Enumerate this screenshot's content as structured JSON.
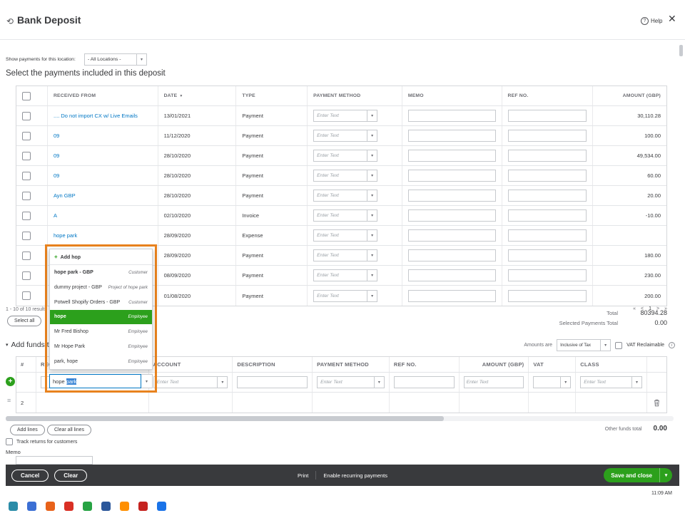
{
  "colors": {
    "accent_green": "#2ca01c",
    "link_blue": "#0077c5",
    "footer_bg": "#393a3d",
    "highlight_orange": "#e8821e"
  },
  "icons": {
    "refresh": "⟲",
    "help_mark": "?",
    "close": "✕",
    "sort_desc": "▼",
    "chevron_down": "▾",
    "info_letter": "i",
    "handle": "≡",
    "plus": "+"
  },
  "header": {
    "title": "Bank Deposit",
    "help": "Help"
  },
  "location": {
    "label": "Show payments for this location:",
    "value": "- All Locations -"
  },
  "payments": {
    "title": "Select the payments included in this deposit",
    "col_received": "RECEIVED FROM",
    "col_date": "DATE",
    "col_type": "TYPE",
    "col_method": "PAYMENT METHOD",
    "col_memo": "MEMO",
    "col_ref": "REF NO.",
    "col_amount": "AMOUNT (GBP)",
    "method_placeholder": "Enter Text",
    "rows": [
      {
        "received_from": ".... Do not import CX w/ Live Emails",
        "date": "13/01/2021",
        "type": "Payment",
        "amount": "30,110.28"
      },
      {
        "received_from": "09",
        "date": "11/12/2020",
        "type": "Payment",
        "amount": "100.00"
      },
      {
        "received_from": "09",
        "date": "28/10/2020",
        "type": "Payment",
        "amount": "49,534.00"
      },
      {
        "received_from": "09",
        "date": "28/10/2020",
        "type": "Payment",
        "amount": "60.00"
      },
      {
        "received_from": "Ayn GBP",
        "date": "28/10/2020",
        "type": "Payment",
        "amount": "20.00"
      },
      {
        "received_from": "A",
        "date": "02/10/2020",
        "type": "Invoice",
        "amount": "-10.00"
      },
      {
        "received_from": "hope park",
        "date": "28/09/2020",
        "type": "Expense",
        "amount": ""
      },
      {
        "received_from": "",
        "date": "28/09/2020",
        "type": "Payment",
        "amount": "180.00"
      },
      {
        "received_from": "",
        "date": "08/09/2020",
        "type": "Payment",
        "amount": "230.00"
      },
      {
        "received_from": "",
        "date": "01/08/2020",
        "type": "Payment",
        "amount": "200.00"
      }
    ],
    "results_summary": "1 - 10 of 10 results",
    "pager": {
      "first": "«",
      "prev": "<",
      "page": "1",
      "next": ">",
      "last": "»"
    },
    "select_all": "Select all",
    "total_label": "Total",
    "total_value": "80394.28",
    "selected_total_label": "Selected Payments Total",
    "selected_total_value": "0.00"
  },
  "name_dropdown": {
    "add_new": "Add hop",
    "items": [
      {
        "name": "hope park - GBP",
        "tag": "Customer"
      },
      {
        "name": "dummy project - GBP",
        "tag": "Project of hope park"
      },
      {
        "name": "Potwell Shopify Orders - GBP",
        "tag": "Customer"
      },
      {
        "name": "hope",
        "tag": "Employee"
      },
      {
        "name": "Mr Fred Bishop",
        "tag": "Employee"
      },
      {
        "name": "Mr Hope Park",
        "tag": "Employee"
      },
      {
        "name": "park, hope",
        "tag": "Employee"
      }
    ],
    "input_prefix": "hope ",
    "input_selected": "park"
  },
  "add_funds": {
    "title": "Add funds to this deposit",
    "amounts_are": "Amounts are",
    "amounts_value": "Inclusive of Tax",
    "vat_reclaimable": "VAT Reclaimable",
    "col_num": "#",
    "col_received": "RECEIVED FROM",
    "col_account": "ACCOUNT",
    "col_description": "DESCRIPTION",
    "col_method": "PAYMENT METHOD",
    "col_ref": "REF NO.",
    "col_amount": "AMOUNT (GBP)",
    "col_vat": "VAT",
    "col_class": "CLASS",
    "enter_text": "Enter Text",
    "row2_num": "2",
    "add_lines": "Add lines",
    "clear_all_lines": "Clear all lines",
    "other_funds_label": "Other funds total",
    "other_funds_value": "0.00",
    "track_returns": "Track returns for customers",
    "memo_label": "Memo"
  },
  "footer": {
    "cancel": "Cancel",
    "clear": "Clear",
    "print": "Print",
    "recurring": "Enable recurring payments",
    "save": "Save and close"
  },
  "taskbar": {
    "time": "11:09 AM"
  }
}
